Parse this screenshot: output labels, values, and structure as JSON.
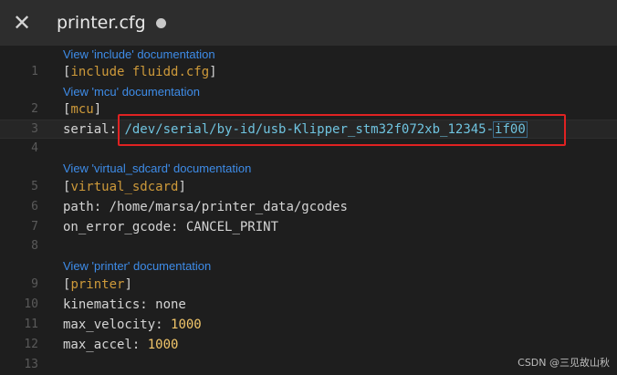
{
  "titlebar": {
    "close_glyph": "✕",
    "filename": "printer.cfg"
  },
  "doc_links": {
    "include": "View 'include' documentation",
    "mcu": "View 'mcu' documentation",
    "virtual_sdcard": "View 'virtual_sdcard' documentation",
    "printer": "View 'printer' documentation"
  },
  "lines": {
    "l1": {
      "num": "1",
      "section": "include fluidd.cfg"
    },
    "l2": {
      "num": "2",
      "section": "mcu"
    },
    "l3": {
      "num": "3",
      "key": "serial:",
      "value_main": "/dev/serial/by-id/usb-Klipper_stm32f072xb_12345-",
      "value_sel": "if00"
    },
    "l4": {
      "num": "4"
    },
    "l5": {
      "num": "5",
      "section": "virtual_sdcard"
    },
    "l6": {
      "num": "6",
      "key": "path:",
      "value": " /home/marsa/printer_data/gcodes"
    },
    "l7": {
      "num": "7",
      "key": "on_error_gcode:",
      "value": " CANCEL_PRINT"
    },
    "l8": {
      "num": "8"
    },
    "l9": {
      "num": "9",
      "section": "printer"
    },
    "l10": {
      "num": "10",
      "key": "kinematics:",
      "value": " none"
    },
    "l11": {
      "num": "11",
      "key": "max_velocity:",
      "value": "1000"
    },
    "l12": {
      "num": "12",
      "key": "max_accel:",
      "value": "1000"
    },
    "l13": {
      "num": "13"
    }
  },
  "watermark": "CSDN @三见故山秋",
  "colors": {
    "background": "#1e1e1e",
    "section_name": "#ce9a3a",
    "number": "#f2c66a",
    "link": "#3e8ce8",
    "highlight_box": "#e02222"
  }
}
